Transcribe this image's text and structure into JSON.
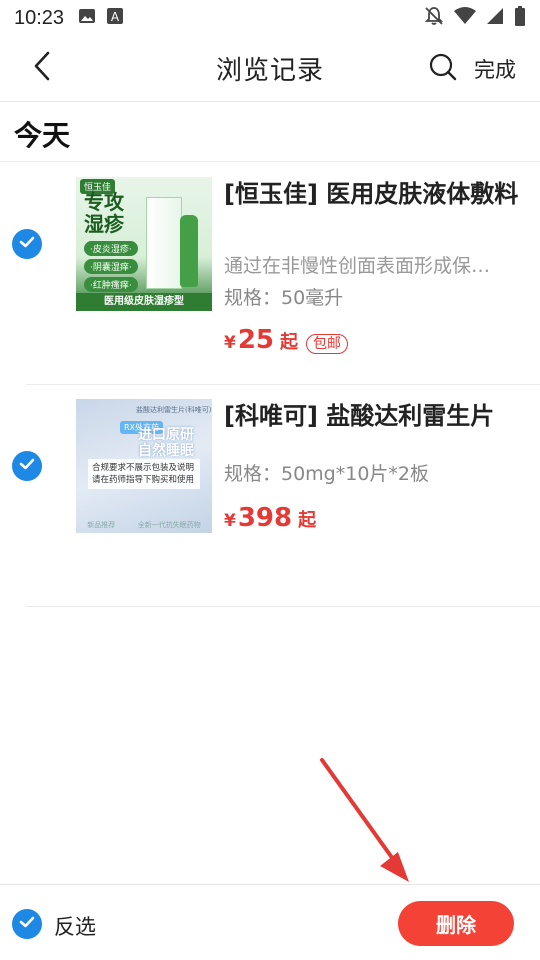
{
  "status_bar": {
    "time": "10:23",
    "left_icons": [
      "image-icon",
      "text-a-icon"
    ],
    "right_icons": [
      "notification-off-icon",
      "wifi-icon",
      "signal-icon",
      "battery-icon"
    ]
  },
  "header": {
    "title": "浏览记录",
    "done_label": "完成"
  },
  "section": {
    "title": "今天"
  },
  "items": [
    {
      "name": "[恒玉佳] 医用皮肤液体敷料",
      "description": "通过在非慢性创面表面形成保护层…",
      "spec": "规格：50毫升",
      "currency": "¥",
      "price": "25",
      "price_suffix": "起",
      "badge": "包邮",
      "checked": true,
      "thumb": {
        "brand": "恒玉佳",
        "headline_1": "专攻",
        "headline_2": "湿疹",
        "tags": [
          "·皮炎湿疹·",
          "·阴囊湿痒·",
          "·红肿瘙痒·"
        ],
        "footer": "医用级皮肤湿疹型"
      }
    },
    {
      "name": "[科唯可] 盐酸达利雷生片",
      "spec": "规格：50mg*10片*2板",
      "currency": "¥",
      "price": "398",
      "price_suffix": "起",
      "checked": true,
      "thumb": {
        "top_text": "盐酸达利雷生片(科唯可)",
        "badge": "RX处方药",
        "headline_1": "进口原研",
        "headline_2": "自然睡眠",
        "notice_1": "合规要求不展示包装及说明",
        "notice_2": "请在药师指导下购买和使用",
        "footer_left": "新品推荐",
        "footer_right": "全新一代抗失眠药物"
      }
    }
  ],
  "bottom_bar": {
    "invert_label": "反选",
    "delete_label": "删除"
  },
  "colors": {
    "accent_blue": "#1e88e5",
    "price_red": "#e53935",
    "delete_red": "#f44336"
  }
}
